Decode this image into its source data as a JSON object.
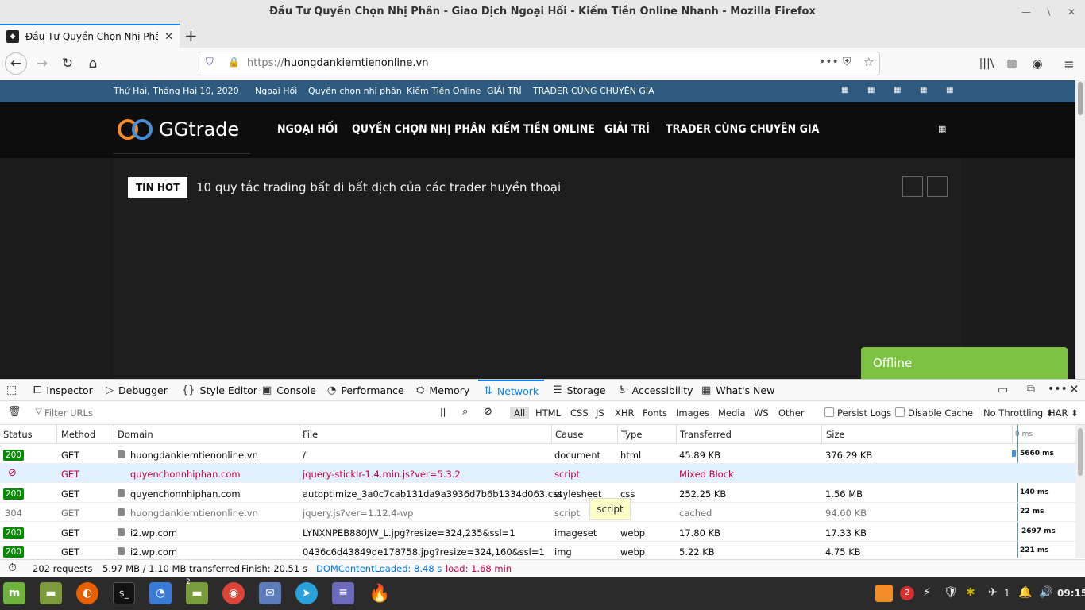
{
  "window": {
    "title": "Đầu Tư Quyền Chọn Nhị Phân - Giao Dịch Ngoại Hối - Kiếm Tiền Online Nhanh - Mozilla Firefox"
  },
  "tab": {
    "title": "Đầu Tư Quyền Chọn Nhị Phâ"
  },
  "url": {
    "scheme": "https://",
    "host": "huongdankiemtienonline.vn"
  },
  "site": {
    "date": "Thứ Hai, Tháng Hai 10, 2020",
    "top_links": [
      "Ngoại Hối",
      "Quyền chọn nhị phân",
      "Kiếm Tiền Online",
      "GIẢI TRÍ",
      "TRADER CÙNG CHUYÊN GIA"
    ],
    "logo_text": "GGtrade",
    "main_nav": [
      "NGOẠI HỐI",
      "QUYỀN CHỌN NHỊ PHÂN",
      "KIẾM TIỀN ONLINE",
      "GIẢI TRÍ",
      "TRADER CÙNG CHUYÊN GIA"
    ],
    "tin_hot": "TIN HOT",
    "headline": "10 quy tắc trading bất di bất dịch của các trader huyền thoại",
    "chat_status": "Offline"
  },
  "devtools": {
    "tabs": [
      "Inspector",
      "Debugger",
      "Style Editor",
      "Console",
      "Performance",
      "Memory",
      "Network",
      "Storage",
      "Accessibility",
      "What's New"
    ],
    "filter_placeholder": "Filter URLs",
    "filters": [
      "All",
      "HTML",
      "CSS",
      "JS",
      "XHR",
      "Fonts",
      "Images",
      "Media",
      "WS",
      "Other"
    ],
    "persist_logs": "Persist Logs",
    "disable_cache": "Disable Cache",
    "throttling": "No Throttling ⬍",
    "har": "HAR ⬍",
    "columns": [
      "Status",
      "Method",
      "Domain",
      "File",
      "Cause",
      "Type",
      "Transferred",
      "Size"
    ],
    "waterfall_label": "0 ms",
    "rows": [
      {
        "status": "200",
        "method": "GET",
        "domain": "huongdankiemtienonline.vn",
        "file": "/",
        "cause": "document",
        "type": "html",
        "transferred": "45.89 KB",
        "size": "376.29 KB",
        "time": "5660 ms"
      },
      {
        "status": "",
        "method": "GET",
        "domain": "quyenchonnhiphan.com",
        "file": "jquery-stickIr-1.4.min.js?ver=5.3.2",
        "cause": "script",
        "type": "",
        "transferred": "Mixed Block",
        "size": "",
        "time": ""
      },
      {
        "status": "200",
        "method": "GET",
        "domain": "quyenchonnhiphan.com",
        "file": "autoptimize_3a0c7cab131da9a3936d7b6b1334d063.css",
        "cause": "stylesheet",
        "type": "css",
        "transferred": "252.25 KB",
        "size": "1.56 MB",
        "time": "140 ms"
      },
      {
        "status": "304",
        "method": "GET",
        "domain": "huongdankiemtienonline.vn",
        "file": "jquery.js?ver=1.12.4-wp",
        "cause": "script",
        "type": "",
        "transferred": "cached",
        "size": "94.60 KB",
        "time": "22 ms"
      },
      {
        "status": "200",
        "method": "GET",
        "domain": "i2.wp.com",
        "file": "LYNXNPEB880JW_L.jpg?resize=324,235&ssl=1",
        "cause": "imageset",
        "type": "webp",
        "transferred": "17.80 KB",
        "size": "17.33 KB",
        "time": "2697 ms"
      },
      {
        "status": "200",
        "method": "GET",
        "domain": "i2.wp.com",
        "file": "0436c6d43849de178758.jpg?resize=324,160&ssl=1",
        "cause": "img",
        "type": "webp",
        "transferred": "5.22 KB",
        "size": "4.75 KB",
        "time": "221 ms"
      }
    ],
    "tooltip": "script",
    "summary": {
      "requests": "202 requests",
      "transferred": "5.97 MB / 1.10 MB transferred",
      "finish": "Finish: 20.51 s",
      "dcl": "DOMContentLoaded: 8.48 s",
      "load": "load: 1.68 min"
    }
  },
  "taskbar": {
    "badge": "2",
    "tray_count": "1",
    "files_badge": "2",
    "clock": "09:15"
  },
  "colors": {
    "accent": "#0a84ff",
    "topbar": "#2d5a7e",
    "chat": "#7dc242",
    "status_ok": "#058b00",
    "blocked": "#c50042"
  }
}
